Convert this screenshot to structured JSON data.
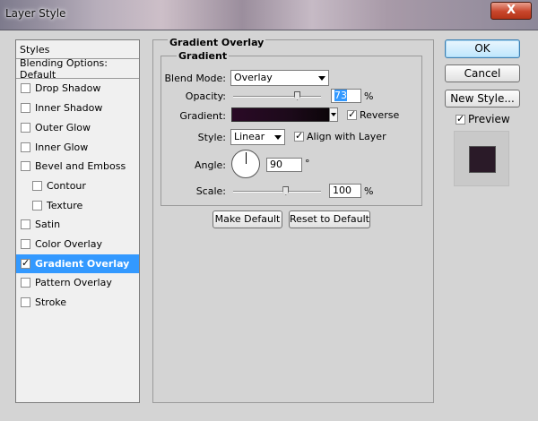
{
  "window": {
    "title": "Layer Style",
    "close_label": "X"
  },
  "sidebar": {
    "items": [
      {
        "label": "Styles",
        "checkbox": false,
        "checked": false,
        "indent": 0,
        "selected": false
      },
      {
        "label": "Blending Options: Default",
        "checkbox": false,
        "checked": false,
        "indent": 0,
        "selected": false
      },
      {
        "label": "Drop Shadow",
        "checkbox": true,
        "checked": false,
        "indent": 0,
        "selected": false
      },
      {
        "label": "Inner Shadow",
        "checkbox": true,
        "checked": false,
        "indent": 0,
        "selected": false
      },
      {
        "label": "Outer Glow",
        "checkbox": true,
        "checked": false,
        "indent": 0,
        "selected": false
      },
      {
        "label": "Inner Glow",
        "checkbox": true,
        "checked": false,
        "indent": 0,
        "selected": false
      },
      {
        "label": "Bevel and Emboss",
        "checkbox": true,
        "checked": false,
        "indent": 0,
        "selected": false
      },
      {
        "label": "Contour",
        "checkbox": true,
        "checked": false,
        "indent": 1,
        "selected": false
      },
      {
        "label": "Texture",
        "checkbox": true,
        "checked": false,
        "indent": 1,
        "selected": false
      },
      {
        "label": "Satin",
        "checkbox": true,
        "checked": false,
        "indent": 0,
        "selected": false
      },
      {
        "label": "Color Overlay",
        "checkbox": true,
        "checked": false,
        "indent": 0,
        "selected": false
      },
      {
        "label": "Gradient Overlay",
        "checkbox": true,
        "checked": true,
        "indent": 0,
        "selected": true
      },
      {
        "label": "Pattern Overlay",
        "checkbox": true,
        "checked": false,
        "indent": 0,
        "selected": false
      },
      {
        "label": "Stroke",
        "checkbox": true,
        "checked": false,
        "indent": 0,
        "selected": false
      }
    ]
  },
  "panel": {
    "title": "Gradient Overlay",
    "group_title": "Gradient",
    "blend_mode": {
      "label": "Blend Mode:",
      "value": "Overlay"
    },
    "opacity": {
      "label": "Opacity:",
      "value": "73",
      "unit": "%",
      "level": 0.73
    },
    "gradient": {
      "label": "Gradient:",
      "reverse_label": "Reverse",
      "reverse_checked": true
    },
    "style": {
      "label": "Style:",
      "value": "Linear",
      "align_label": "Align with Layer",
      "align_checked": true
    },
    "angle": {
      "label": "Angle:",
      "value": "90",
      "unit": "°"
    },
    "scale": {
      "label": "Scale:",
      "value": "100",
      "unit": "%",
      "level": 0.6
    },
    "make_default_label": "Make Default",
    "reset_default_label": "Reset to Default"
  },
  "actions": {
    "ok_label": "OK",
    "cancel_label": "Cancel",
    "new_style_label": "New Style...",
    "preview_label": "Preview",
    "preview_checked": true
  },
  "colors": {
    "selection": "#3399ff",
    "gradient_dark": "#1c0a1a",
    "preview_swatch": "#2a1a28"
  }
}
